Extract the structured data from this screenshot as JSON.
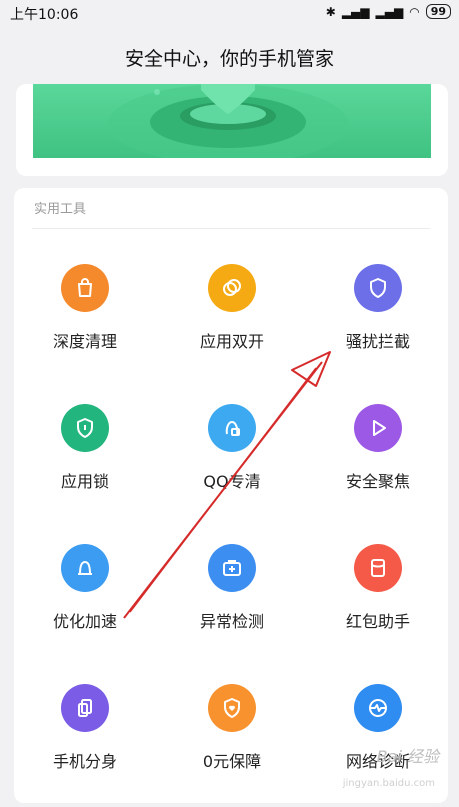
{
  "status": {
    "time": "上午10:06",
    "battery": "99"
  },
  "header": {
    "title": "安全中心，你的手机管家"
  },
  "tools": {
    "section_title": "实用工具",
    "items": [
      {
        "label": "深度清理",
        "icon": "cleanup-bag-icon",
        "color": "#f58a2c"
      },
      {
        "label": "应用双开",
        "icon": "dual-app-icon",
        "color": "#f5a912"
      },
      {
        "label": "骚扰拦截",
        "icon": "shield-icon",
        "color": "#6c6fe8"
      },
      {
        "label": "应用锁",
        "icon": "app-lock-shield-icon",
        "color": "#22b57d"
      },
      {
        "label": "QQ专清",
        "icon": "qq-clean-icon",
        "color": "#3da9f0"
      },
      {
        "label": "安全聚焦",
        "icon": "play-triangle-icon",
        "color": "#9b59e6"
      },
      {
        "label": "优化加速",
        "icon": "bell-boost-icon",
        "color": "#3c9cf2"
      },
      {
        "label": "异常检测",
        "icon": "medical-kit-icon",
        "color": "#3c8ff0"
      },
      {
        "label": "红包助手",
        "icon": "red-packet-icon",
        "color": "#f45a47"
      },
      {
        "label": "手机分身",
        "icon": "phone-clone-icon",
        "color": "#7a5ce6"
      },
      {
        "label": "0元保障",
        "icon": "heart-shield-icon",
        "color": "#f7922f"
      },
      {
        "label": "网络诊断",
        "icon": "network-wave-icon",
        "color": "#2f8cf0"
      }
    ]
  },
  "watermark": {
    "text": "Bai 经验",
    "sub": "jingyan.baidu.com"
  }
}
